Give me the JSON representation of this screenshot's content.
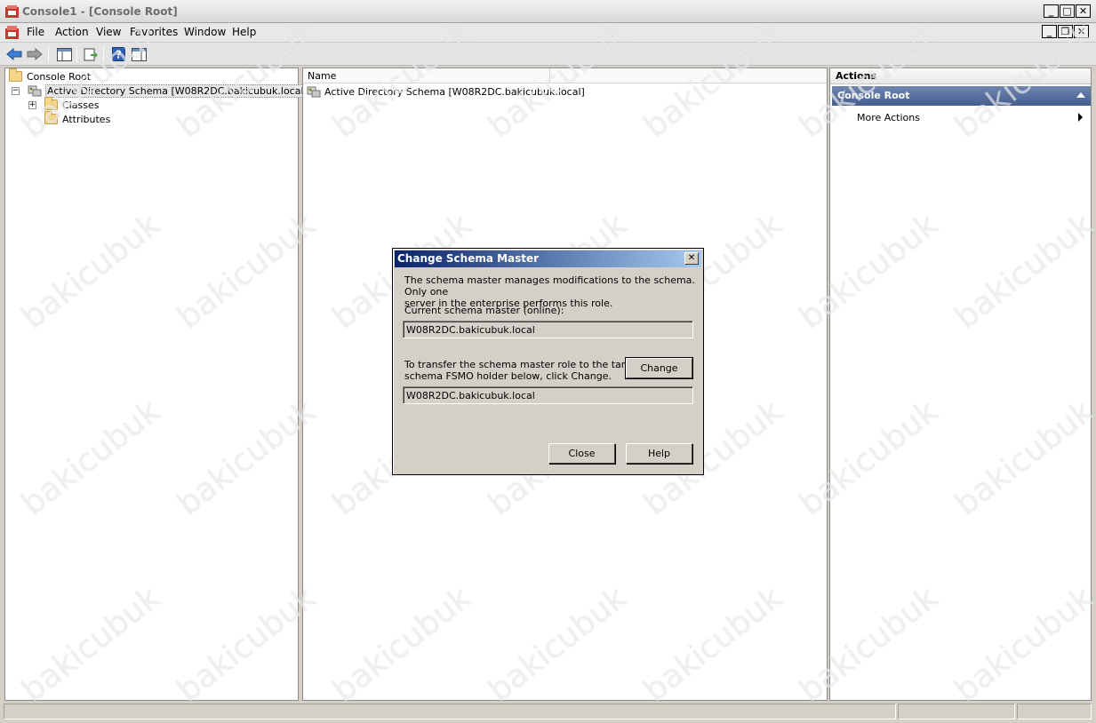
{
  "window": {
    "title": "Console1 - [Console Root]"
  },
  "menubar": {
    "items": [
      "File",
      "Action",
      "View",
      "Favorites",
      "Window",
      "Help"
    ]
  },
  "tree": {
    "root_label": "Console Root",
    "schema_label": "Active Directory Schema [W08R2DC.bakicubuk.local]",
    "classes_label": "Classes",
    "attributes_label": "Attributes"
  },
  "list": {
    "column_name": "Name",
    "rows": [
      "Active Directory Schema [W08R2DC.bakicubuk.local]"
    ]
  },
  "actions": {
    "header": "Actions",
    "section_title": "Console Root",
    "item": "More Actions"
  },
  "dialog": {
    "title": "Change Schema Master",
    "description_line1": "The schema master manages modifications to the schema. Only one",
    "description_line2": "server in the enterprise performs this role.",
    "current_label": "Current schema master (online):",
    "current_value": "W08R2DC.bakicubuk.local",
    "transfer_line1": "To transfer the schema master role to the targeted",
    "transfer_line2": "schema FSMO holder below, click Change.",
    "target_value": "W08R2DC.bakicubuk.local",
    "change_button": "Change",
    "close_button": "Close",
    "help_button": "Help"
  },
  "watermark": {
    "text": "bakicubuk"
  },
  "colors": {
    "dialog_title_start": "#0a246a",
    "dialog_title_end": "#a6caf0",
    "actions_section": "#4f6a9c"
  }
}
